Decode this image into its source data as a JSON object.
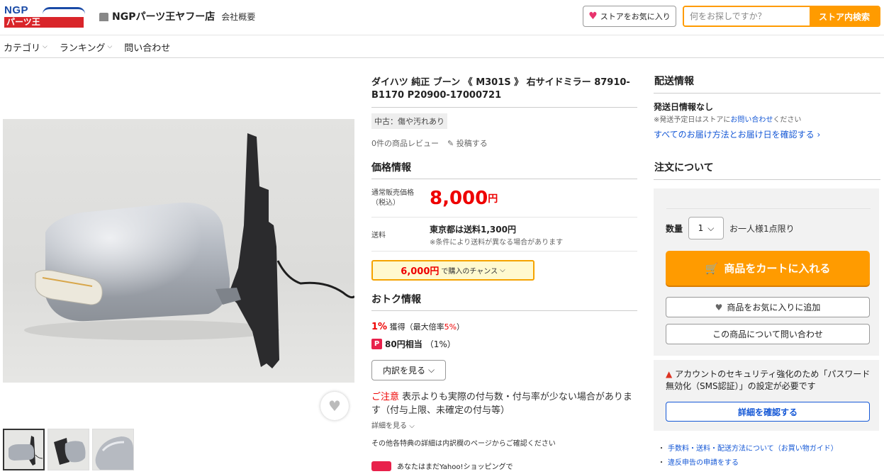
{
  "header": {
    "logo_top": "NGP",
    "logo_bottom": "パーツ王",
    "store_name": "NGPパーツ王ヤフー店",
    "about_link": "会社概要",
    "fav_store": "ストアをお気に入り",
    "search_placeholder": "何をお探しですか？",
    "search_button": "ストア内検索"
  },
  "nav": {
    "category": "カテゴリ",
    "ranking": "ランキング",
    "contact": "問い合わせ"
  },
  "product": {
    "title": "ダイハツ 純正 ブーン 《 M301S 》 右サイドミラー 87910-B1170 P20900-17000721",
    "condition": "中古：傷や汚れあり",
    "review_count": "0件の商品レビュー",
    "post_review": "投稿する"
  },
  "price": {
    "section_title": "価格情報",
    "label_line1": "通常販売価格",
    "label_line2": "（税込）",
    "value": "8,000",
    "currency": "円",
    "shipping_label": "送料",
    "shipping_value": "東京都は送料1,300円",
    "shipping_note": "※条件により送料が異なる場合があります",
    "chance_price": "6,000円",
    "chance_text": "で購入のチャンス"
  },
  "deals": {
    "section_title": "おトク情報",
    "pct": "1%",
    "gain": "獲得",
    "max_prefix": "（最大倍率",
    "max_value": "5%",
    "max_suffix": "）",
    "pp_icon": "P",
    "pp_amount": "80円相当",
    "pp_pct": "（1%）",
    "breakdown_button": "内訳を見る",
    "warn_head": "ご注意",
    "warn_body": "表示よりも実際の付与数・付与率が少ない場合があります（付与上限、未確定の付与等）",
    "detail_link": "詳細を見る",
    "other_note": "その他各特典の詳細は内訳欄のページからご確認ください",
    "banner_text": "あなたはまだYahoo!ショッピングで"
  },
  "delivery": {
    "section_title": "配送情報",
    "ship_date": "発送日情報なし",
    "note_prefix": "※発送予定日はストアに",
    "note_link": "お問い合わせ",
    "note_suffix": "ください",
    "all_methods": "すべてのお届け方法とお届け日を確認する"
  },
  "order": {
    "section_title": "注文について",
    "qty_label": "数量",
    "qty_value": "1",
    "qty_limit": "お一人様1点限り",
    "cart_button": "商品をカートに入れる",
    "fav_button": "商品をお気に入りに追加",
    "inquiry_button": "この商品について問い合わせ"
  },
  "security": {
    "message": "アカウントのセキュリティ強化のため「パスワード無効化（SMS認証）」の設定が必要です",
    "detail_button": "詳細を確認する"
  },
  "footer_links": [
    "手数料・送料・配送方法について（お買い物ガイド）",
    "違反申告の申請をする"
  ],
  "colors": {
    "accent_orange": "#ff9b00",
    "price_red": "#ee0000",
    "link_blue": "#1558d6"
  }
}
